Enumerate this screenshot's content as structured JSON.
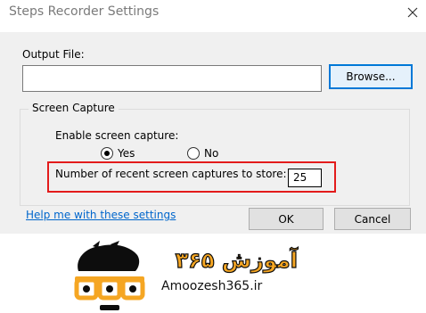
{
  "window": {
    "title": "Steps Recorder Settings"
  },
  "output": {
    "label": "Output File:",
    "value": "",
    "browse_label": "Browse..."
  },
  "screen_capture": {
    "group_label": "Screen Capture",
    "enable_label": "Enable screen capture:",
    "yes_label": "Yes",
    "no_label": "No",
    "selected": "Yes",
    "recent_label": "Number of recent screen captures to store:",
    "recent_value": "25"
  },
  "footer": {
    "help_link": "Help me with these settings",
    "ok_label": "OK",
    "cancel_label": "Cancel"
  },
  "watermark": {
    "logo_text": "آموزش ۳۶۵",
    "site": "Amoozesh365.ir"
  },
  "colors": {
    "highlight": "#e31b1b",
    "logo_orange": "#f5a623",
    "link": "#0066cc",
    "default_button_border": "#0078d7"
  }
}
